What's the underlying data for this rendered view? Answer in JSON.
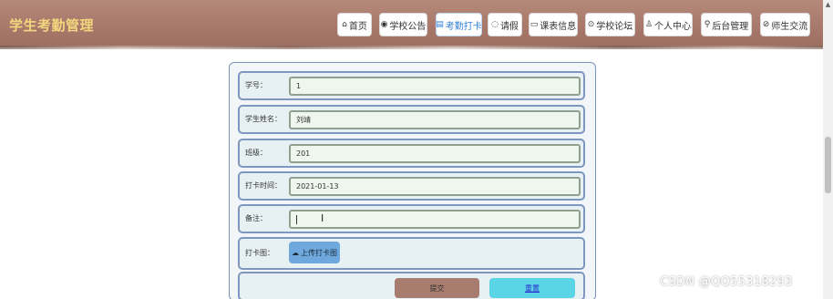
{
  "app": {
    "title": "学生考勤管理"
  },
  "nav": {
    "items": [
      {
        "label": "首页",
        "icon": "home-icon",
        "glyph": "⌂"
      },
      {
        "label": "学校公告",
        "icon": "announcement-icon",
        "glyph": "◉"
      },
      {
        "label": "考勤打卡",
        "icon": "checkin-icon",
        "glyph": "▤",
        "active": true
      },
      {
        "label": "请假",
        "icon": "leave-icon",
        "glyph": "◌"
      },
      {
        "label": "课表信息",
        "icon": "schedule-icon",
        "glyph": "▭"
      },
      {
        "label": "学校论坛",
        "icon": "forum-icon",
        "glyph": "⊙"
      },
      {
        "label": "个人中心",
        "icon": "user-icon",
        "glyph": "♙"
      },
      {
        "label": "后台管理",
        "icon": "link-icon",
        "glyph": "⚲"
      },
      {
        "label": "师生交流",
        "icon": "chat-icon",
        "glyph": "⊘"
      }
    ]
  },
  "form": {
    "fields": [
      {
        "label": "学号：",
        "value": "1"
      },
      {
        "label": "学生姓名：",
        "value": "刘靖"
      },
      {
        "label": "班级：",
        "value": "201"
      },
      {
        "label": "打卡时间：",
        "value": "2021-01-13"
      },
      {
        "label": "备注：",
        "value": ""
      }
    ],
    "upload": {
      "label": "打卡图：",
      "button": "上传打卡图",
      "icon": "cloud-upload-icon"
    },
    "submit": "提交",
    "reset": "重置"
  },
  "watermark": "CSDN @QQ55318293",
  "colors": {
    "header": "#a8786a",
    "brand": "#f2d77e",
    "active_nav": "#2f7dd4",
    "submit": "#a97c70",
    "reset": "#5ad5e6",
    "upload": "#6ea8dc"
  }
}
